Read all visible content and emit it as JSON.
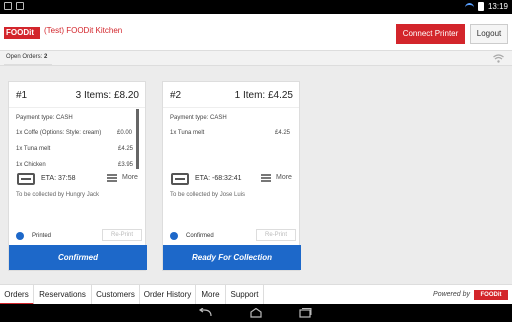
{
  "statusbar": {
    "time": "13:19"
  },
  "header": {
    "logo_text": "FOODit",
    "kitchen_title": "(Test) FOODit Kitchen",
    "connect_label": "Connect Printer",
    "logout_label": "Logout"
  },
  "open_orders": {
    "label": "Open Orders:",
    "count": "2"
  },
  "orders": [
    {
      "number": "#1",
      "summary": "3 Items:  £8.20",
      "payment": "Payment type: CASH",
      "items": [
        {
          "name": "1x Coffe (Options: Style: cream)",
          "price": "£0.00"
        },
        {
          "name": "1x Tuna melt",
          "price": "£4.25"
        },
        {
          "name": "1x Chicken",
          "price": "£3.95"
        }
      ],
      "eta": "ETA: 37:58",
      "more": "More",
      "collected": "To be collected by Hungry Jack",
      "status": "Printed",
      "reprint": "Re-Print",
      "action": "Confirmed"
    },
    {
      "number": "#2",
      "summary": "1 Item:  £4.25",
      "payment": "Payment type: CASH",
      "items": [
        {
          "name": "1x Tuna melt",
          "price": "£4.25"
        }
      ],
      "eta": "ETA: -68:32:41",
      "more": "More",
      "collected": "To be collected by Jose Luis",
      "status": "Confirmed",
      "reprint": "Re-Print",
      "action": "Ready For Collection"
    }
  ],
  "bottom_tabs": [
    {
      "label": "Orders"
    },
    {
      "label": "Reservations"
    },
    {
      "label": "Customers"
    },
    {
      "label": "Order History"
    },
    {
      "label": "More"
    },
    {
      "label": "Support"
    }
  ],
  "powered_by": "Powered by",
  "colors": {
    "brand": "#d3252b",
    "accent": "#1d68c9"
  }
}
